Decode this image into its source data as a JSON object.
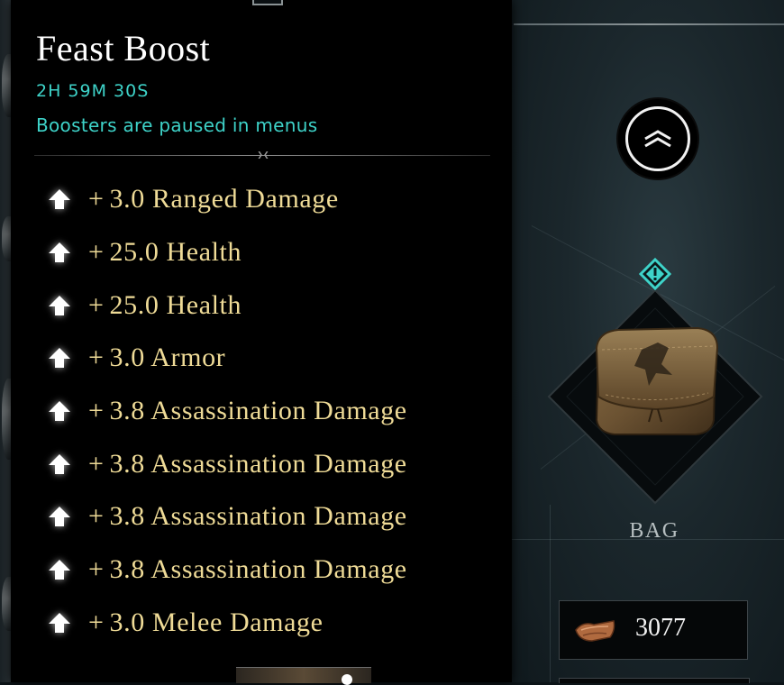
{
  "tooltip": {
    "title": "Feast Boost",
    "timer": "2H 59M 30S",
    "status": "Boosters are paused in menus",
    "stats": [
      {
        "prefix": "+",
        "text": "3.0 Ranged Damage"
      },
      {
        "prefix": "+",
        "text": "25.0 Health"
      },
      {
        "prefix": "+",
        "text": "25.0 Health"
      },
      {
        "prefix": "+",
        "text": "3.0 Armor"
      },
      {
        "prefix": "+",
        "text": "3.8 Assassination Damage"
      },
      {
        "prefix": "+",
        "text": "3.8 Assassination Damage"
      },
      {
        "prefix": "+",
        "text": "3.8 Assassination Damage"
      },
      {
        "prefix": "+",
        "text": "3.8 Assassination Damage"
      },
      {
        "prefix": "+",
        "text": "3.0 Melee Damage"
      }
    ],
    "stat_icon": "arrow-up-icon"
  },
  "inventory": {
    "collapse_icon": "chevron-up-icon",
    "alert_icon": "exclamation-icon",
    "slot_label": "BAG",
    "currency_icon": "leather-icon",
    "currency_value": "3077"
  },
  "colors": {
    "accent_teal": "#3ed3c9",
    "stat_gold": "#efdb97",
    "title_white": "#ffffff"
  }
}
